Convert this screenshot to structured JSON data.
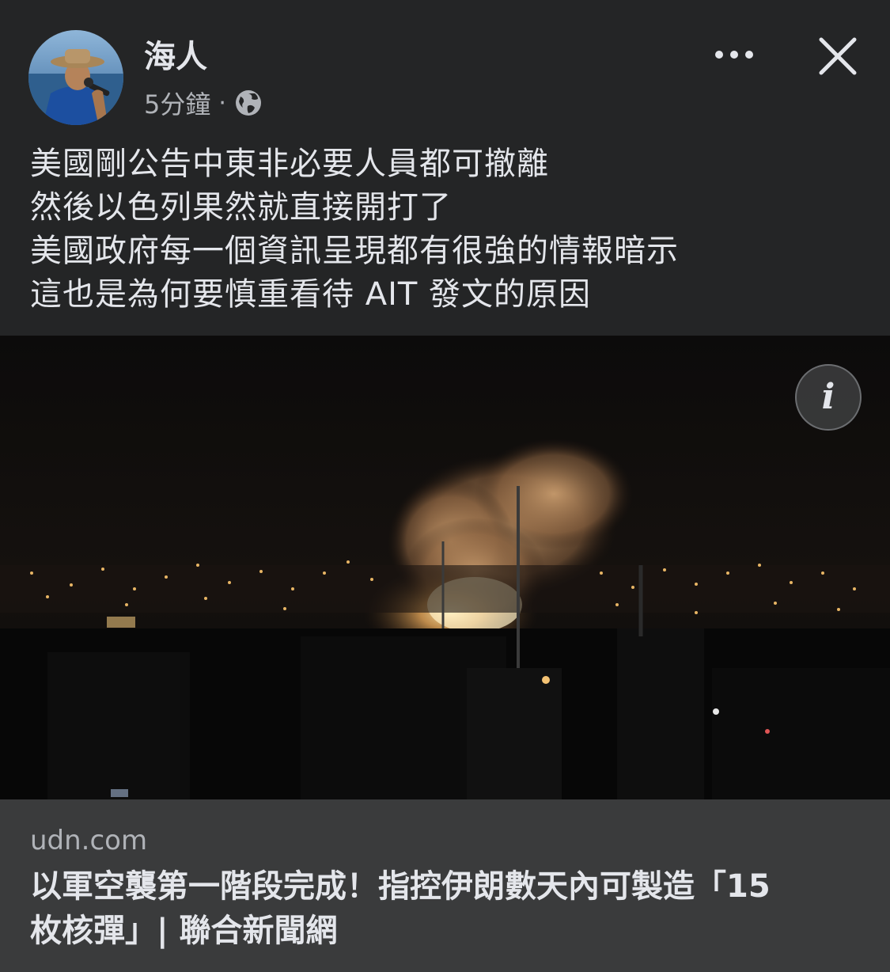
{
  "post": {
    "author": "海人",
    "timestamp": "5分鐘",
    "separator": "·",
    "privacy_icon": "globe-icon",
    "more_icon": "more-options-icon",
    "close_icon": "close-icon",
    "text_lines": [
      "美國剛公告中東非必要人員都可撤離",
      "然後以色列果然就直接開打了",
      "美國政府每一個資訊呈現都有很強的情報暗示",
      "這也是為何要慎重看待 AIT 發文的原因"
    ]
  },
  "link_preview": {
    "info_icon": "info-icon",
    "info_glyph": "i",
    "domain": "udn.com",
    "title_lines": [
      "以軍空襲第一階段完成！指控伊朗數天內可製造「15",
      "枚核彈」| 聯合新聞網"
    ]
  },
  "colors": {
    "background": "#242526",
    "text_primary": "#e4e6eb",
    "text_secondary": "#b0b3b8",
    "link_footer_bg": "#3a3b3c"
  }
}
